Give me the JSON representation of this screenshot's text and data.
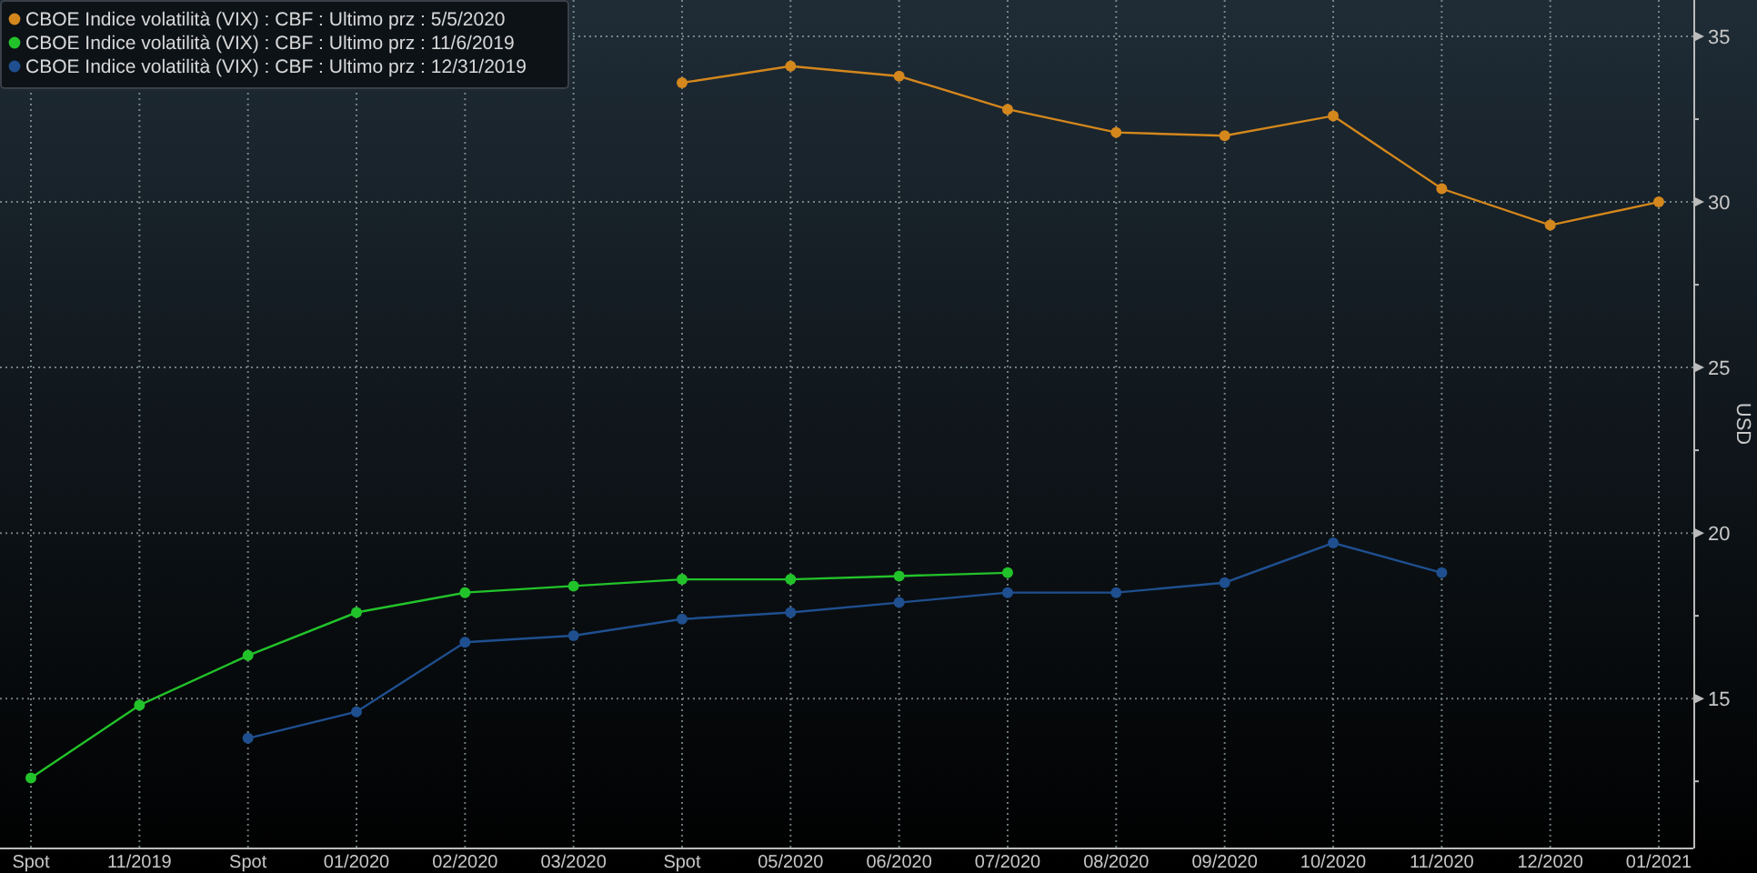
{
  "chart": {
    "chart_data": {
      "type": "line",
      "ylabel": "USD",
      "grid": true,
      "legend": true,
      "categories": [
        "Spot",
        "11/2019",
        "Spot",
        "01/2020",
        "02/2020",
        "03/2020",
        "Spot",
        "05/2020",
        "06/2020",
        "07/2020",
        "08/2020",
        "09/2020",
        "10/2020",
        "11/2020",
        "12/2020",
        "01/2021"
      ],
      "series": [
        {
          "name": "CBOE Indice volatilità (VIX) : CBF : Ultimo prz : 5/5/2020",
          "color": "#d4871c",
          "marker": "circle",
          "values": [
            null,
            null,
            null,
            null,
            null,
            null,
            33.6,
            34.1,
            33.8,
            32.8,
            32.1,
            32.0,
            32.6,
            30.4,
            29.3,
            30.0
          ]
        },
        {
          "name": "CBOE Indice volatilità (VIX) : CBF : Ultimo prz : 11/6/2019",
          "color": "#22c32a",
          "marker": "circle",
          "values": [
            12.6,
            14.8,
            16.3,
            17.6,
            18.2,
            18.4,
            18.6,
            18.6,
            18.7,
            18.8,
            null,
            null,
            null,
            null,
            null,
            null
          ]
        },
        {
          "name": "CBOE Indice volatilità (VIX) : CBF : Ultimo prz : 12/31/2019",
          "color": "#1f4f8f",
          "marker": "circle",
          "values": [
            null,
            null,
            13.8,
            14.6,
            16.7,
            16.9,
            17.4,
            17.6,
            17.9,
            18.2,
            18.2,
            18.5,
            19.7,
            18.8,
            null,
            null
          ]
        }
      ],
      "ylim": [
        10.5,
        36.1
      ],
      "yticks": [
        15,
        20,
        25,
        30,
        35
      ]
    }
  }
}
